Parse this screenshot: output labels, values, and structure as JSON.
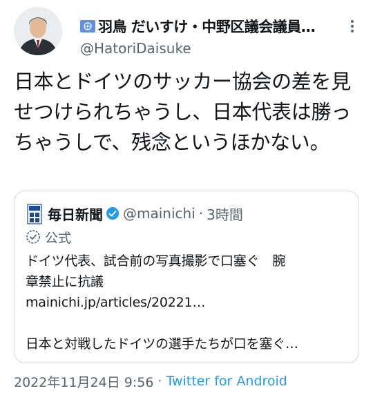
{
  "author": {
    "display_name": "羽鳥 だいすけ・中野区議会議員…",
    "handle": "@HatoriDaisuke",
    "flag_icon": "un-flag-icon",
    "more_icon": "more-options-icon"
  },
  "tweet": {
    "text": "日本とドイツのサッカー協会の差を見せつけられちゃうし、日本代表は勝っちゃうしで、残念というほかない。"
  },
  "quote": {
    "logo_icon": "mainichi-logo-icon",
    "name": "毎日新聞",
    "handle": "@mainichi",
    "separator": "·",
    "time": "3時間",
    "label": "公式",
    "lines": [
      "ドイツ代表、試合前の写真撮影で口塞ぐ　腕",
      "章禁止に抗議",
      "mainichi.jp/articles/20221…",
      "",
      "日本と対戦したドイツの選手たちが口を塞ぐ…"
    ]
  },
  "footer": {
    "timestamp": "2022年11月24日 9:56",
    "separator": "·",
    "source": "Twitter for Android"
  },
  "colors": {
    "text": "#0f1419",
    "secondary": "#536471",
    "link": "#1d9bf0",
    "border": "#cfd9de",
    "verified": "#1d9bf0"
  }
}
